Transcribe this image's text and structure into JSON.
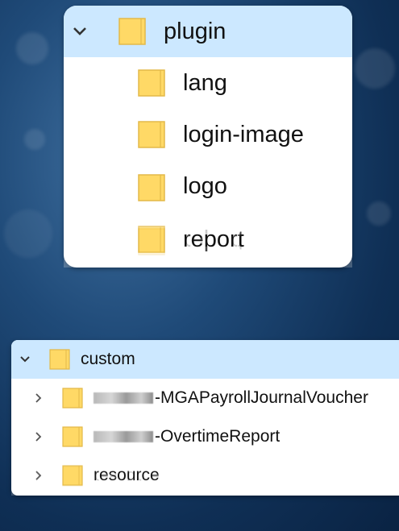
{
  "top_panel": {
    "parent": {
      "label": "plugin",
      "expanded": true
    },
    "children": [
      {
        "label": "lang"
      },
      {
        "label": "login-image"
      },
      {
        "label": "logo"
      },
      {
        "label": "report"
      }
    ],
    "reflection_label": "report"
  },
  "bottom_panel": {
    "parent": {
      "label": "custom",
      "expanded": true
    },
    "children": [
      {
        "label": "-MGAPayrollJournalVoucher",
        "redacted_prefix": true
      },
      {
        "label": "-OvertimeReport",
        "redacted_prefix": true
      },
      {
        "label": "resource",
        "redacted_prefix": false
      }
    ],
    "reflection_label": "resource"
  },
  "colors": {
    "selection": "#cce8ff",
    "folder_fill": "#ffd966",
    "folder_edge": "#e3b949"
  },
  "icons": [
    "chevron-down-icon",
    "chevron-right-icon",
    "folder-icon"
  ]
}
